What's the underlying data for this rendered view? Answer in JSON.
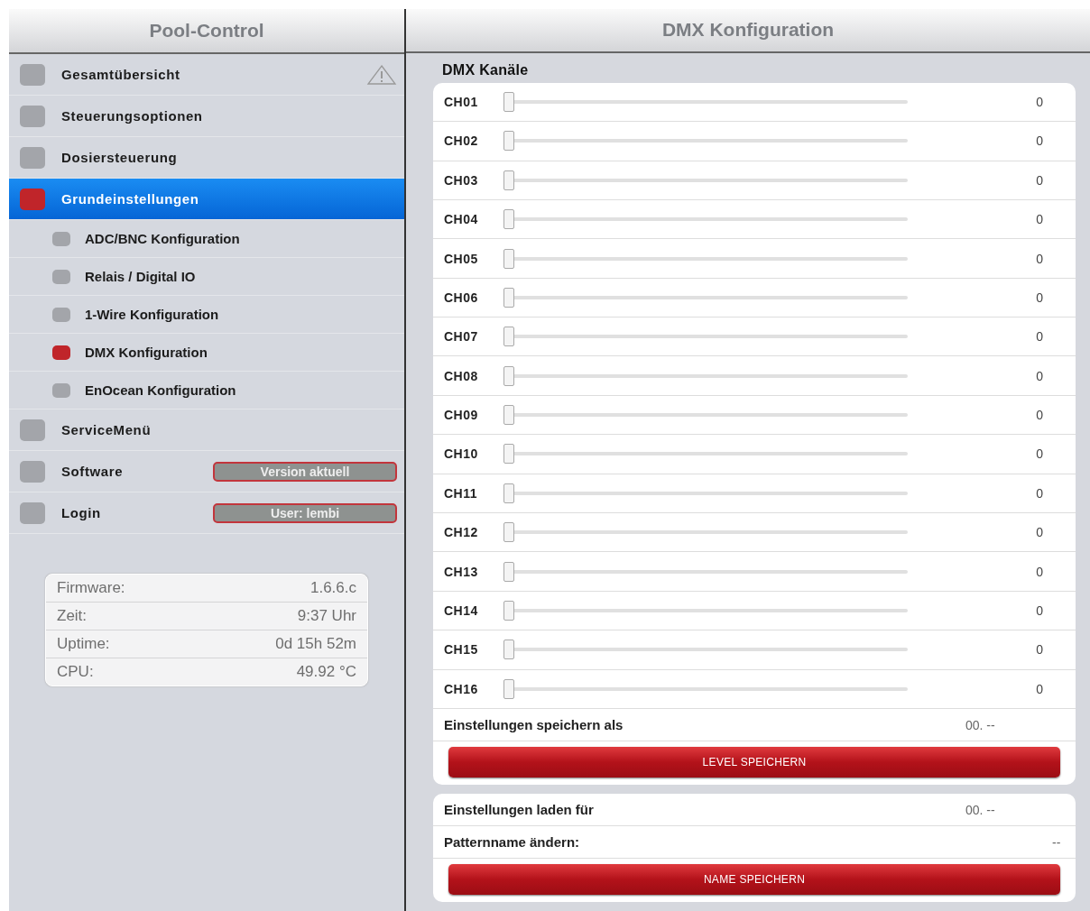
{
  "sidebar": {
    "title": "Pool-Control",
    "items": [
      {
        "label": "Gesamtübersicht",
        "kind": "top",
        "selected": false,
        "warning": true
      },
      {
        "label": "Steuerungsoptionen",
        "kind": "top",
        "selected": false
      },
      {
        "label": "Dosiersteuerung",
        "kind": "top",
        "selected": false
      },
      {
        "label": "Grundeinstellungen",
        "kind": "top",
        "selected": true
      },
      {
        "label": "ADC/BNC Konfiguration",
        "kind": "sub",
        "selected": false
      },
      {
        "label": "Relais / Digital IO",
        "kind": "sub",
        "selected": false
      },
      {
        "label": "1-Wire Konfiguration",
        "kind": "sub",
        "selected": false
      },
      {
        "label": "DMX Konfiguration",
        "kind": "sub",
        "selected": true
      },
      {
        "label": "EnOcean Konfiguration",
        "kind": "sub",
        "selected": false
      },
      {
        "label": "ServiceMenü",
        "kind": "top",
        "selected": false
      },
      {
        "label": "Software",
        "kind": "top",
        "selected": false,
        "badge": "Version aktuell"
      },
      {
        "label": "Login",
        "kind": "top",
        "selected": false,
        "badge": "User: lembi"
      }
    ],
    "info": [
      {
        "label": "Firmware:",
        "value": "1.6.6.c"
      },
      {
        "label": "Zeit:",
        "value": "9:37 Uhr"
      },
      {
        "label": "Uptime:",
        "value": "0d 15h 52m"
      },
      {
        "label": "CPU:",
        "value": "49.92 °C"
      }
    ]
  },
  "main": {
    "title": "DMX Konfiguration",
    "section": "DMX Kanäle",
    "channels": [
      {
        "name": "CH01",
        "level": 0,
        "reading": "0"
      },
      {
        "name": "CH02",
        "level": 0,
        "reading": "0"
      },
      {
        "name": "CH03",
        "level": 0,
        "reading": "0"
      },
      {
        "name": "CH04",
        "level": 0,
        "reading": "0"
      },
      {
        "name": "CH05",
        "level": 0,
        "reading": "0"
      },
      {
        "name": "CH06",
        "level": 0,
        "reading": "0"
      },
      {
        "name": "CH07",
        "level": 0,
        "reading": "0"
      },
      {
        "name": "CH08",
        "level": 0,
        "reading": "0"
      },
      {
        "name": "CH09",
        "level": 0,
        "reading": "0"
      },
      {
        "name": "CH10",
        "level": 0,
        "reading": "0"
      },
      {
        "name": "CH11",
        "level": 0,
        "reading": "0"
      },
      {
        "name": "CH12",
        "level": 0,
        "reading": "0"
      },
      {
        "name": "CH13",
        "level": 0,
        "reading": "0"
      },
      {
        "name": "CH14",
        "level": 0,
        "reading": "0"
      },
      {
        "name": "CH15",
        "level": 0,
        "reading": "0"
      },
      {
        "name": "CH16",
        "level": 0,
        "reading": "0"
      }
    ],
    "save": {
      "label": "Einstellungen speichern als",
      "value": "00. --",
      "button": "LEVEL SPEICHERN"
    },
    "load": {
      "label": "Einstellungen laden für",
      "value": "00. --"
    },
    "pattern": {
      "label": "Patternname ändern:",
      "value": "--",
      "button": "NAME SPEICHERN"
    }
  }
}
